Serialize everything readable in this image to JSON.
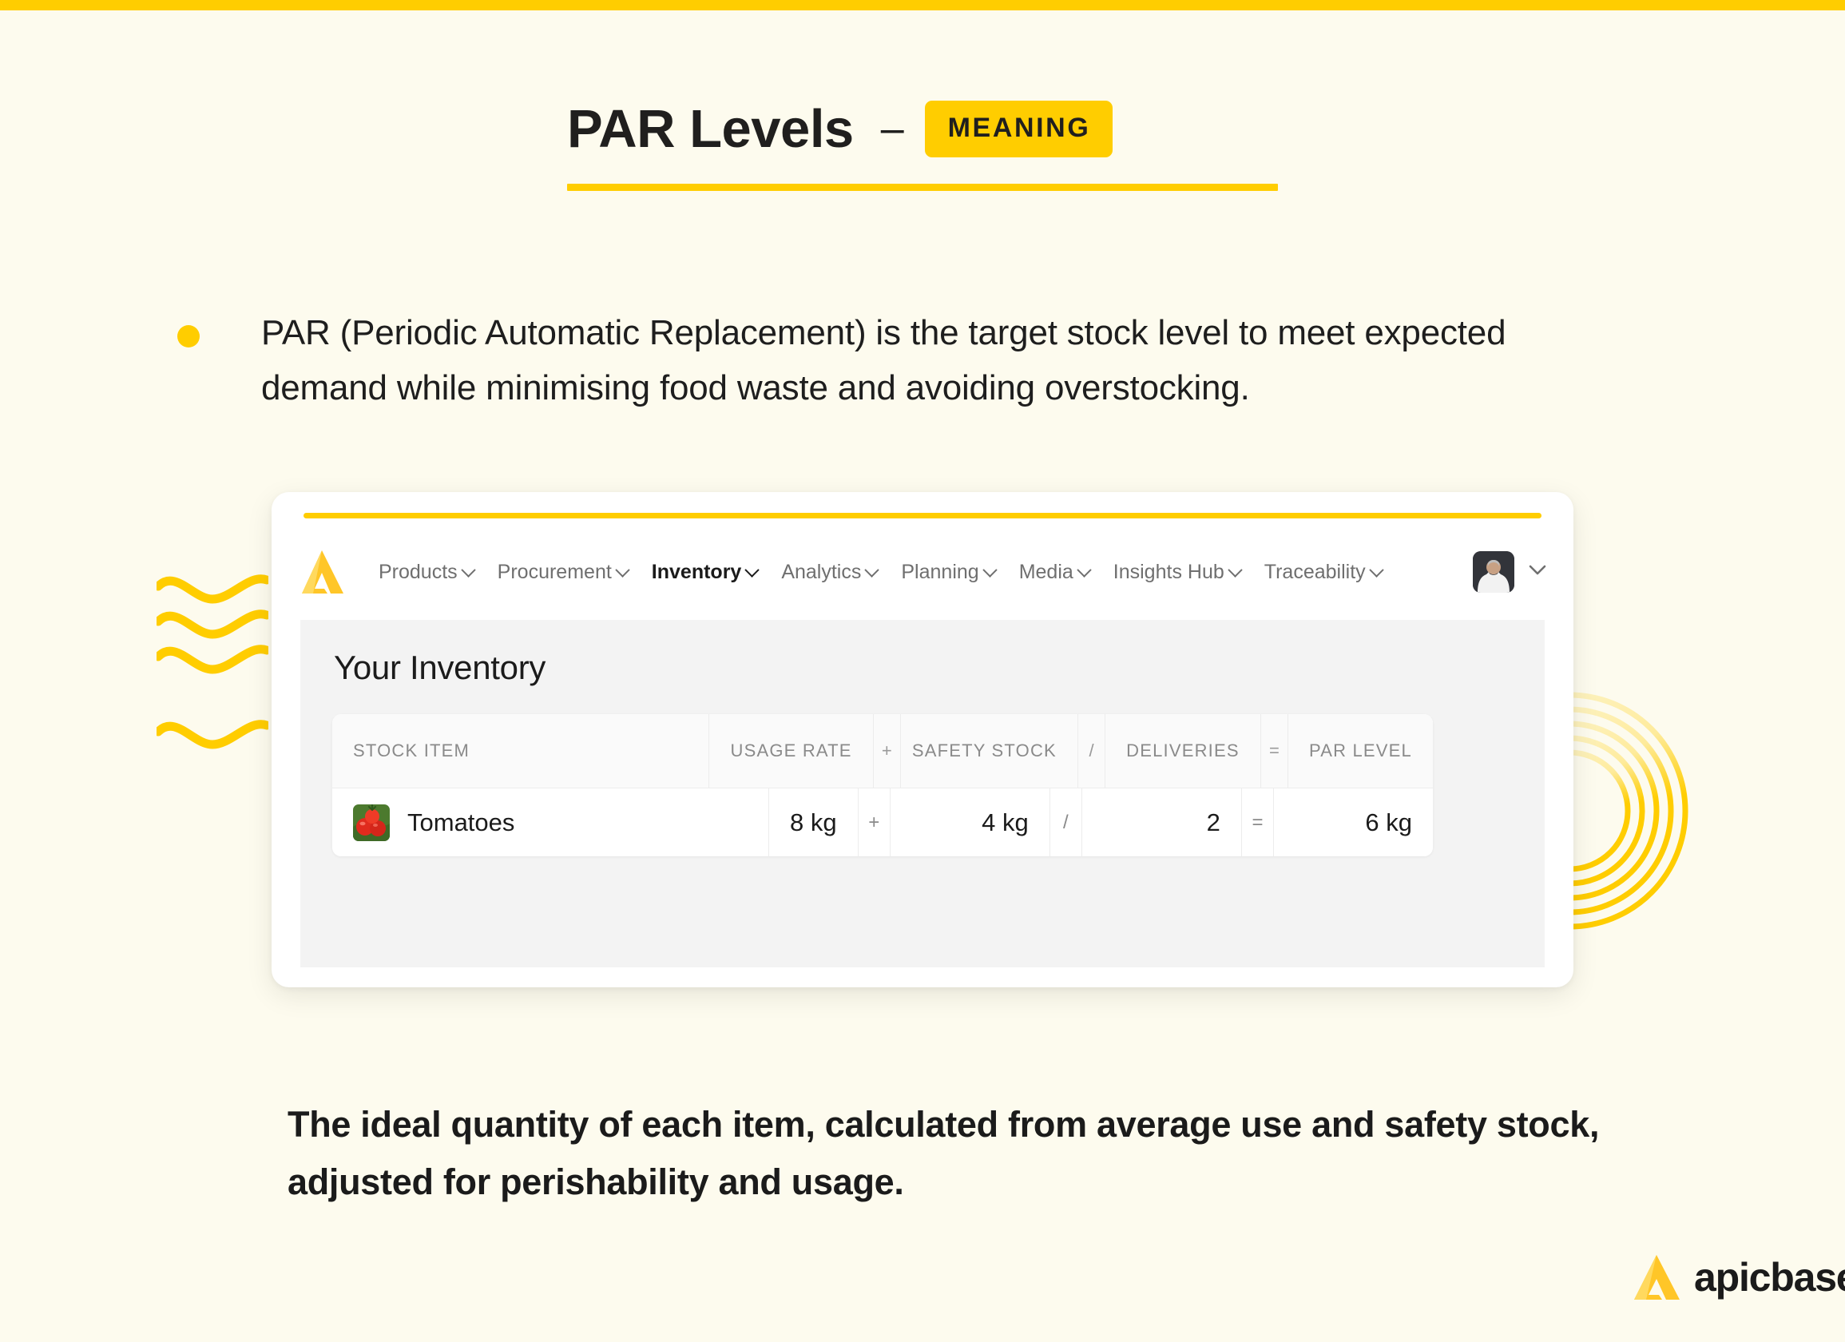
{
  "theme": {
    "background": "#FDFBEE",
    "accent_yellow": "#FFCD00",
    "text_dark": "#1B1B1B",
    "muted": "#8A8A8A",
    "card_white": "#FFFFFF",
    "pane_gray": "#F3F3F3"
  },
  "header": {
    "title": "PAR Levels",
    "dash": "–",
    "badge": "MEANING"
  },
  "intro": {
    "bullet_text": "PAR (Periodic Automatic Replacement) is the target stock level to meet expected demand while minimising food waste and avoiding overstocking."
  },
  "app": {
    "brand_icon": "apicbase-a-logo",
    "nav": [
      {
        "label": "Products",
        "active": false,
        "has_chevron": true
      },
      {
        "label": "Procurement",
        "active": false,
        "has_chevron": true
      },
      {
        "label": "Inventory",
        "active": true,
        "has_chevron": true
      },
      {
        "label": "Analytics",
        "active": false,
        "has_chevron": true
      },
      {
        "label": "Planning",
        "active": false,
        "has_chevron": true
      },
      {
        "label": "Media",
        "active": false,
        "has_chevron": true
      },
      {
        "label": "Insights Hub",
        "active": false,
        "has_chevron": true
      },
      {
        "label": "Traceability",
        "active": false,
        "has_chevron": true
      }
    ],
    "avatar": "user-avatar-photo",
    "avatar_chevron": "chevron-down-icon",
    "page_title": "Your Inventory",
    "table": {
      "columns": [
        {
          "key": "stock_item",
          "label": "STOCK ITEM",
          "align": "left"
        },
        {
          "key": "usage_rate",
          "label": "USAGE RATE",
          "align": "right"
        },
        {
          "key": "op1",
          "label": "+",
          "align": "center"
        },
        {
          "key": "safety_stock",
          "label": "SAFETY STOCK",
          "align": "right"
        },
        {
          "key": "op2",
          "label": "/",
          "align": "center"
        },
        {
          "key": "deliveries",
          "label": "DELIVERIES",
          "align": "right"
        },
        {
          "key": "op3",
          "label": "=",
          "align": "center"
        },
        {
          "key": "par_level",
          "label": "PAR LEVEL",
          "align": "right"
        }
      ],
      "rows": [
        {
          "thumbnail": "tomatoes-photo",
          "stock_item": "Tomatoes",
          "usage_rate": "8 kg",
          "op1": "+",
          "safety_stock": "4 kg",
          "op2": "/",
          "deliveries": "2",
          "op3": "=",
          "par_level": "6 kg"
        }
      ]
    }
  },
  "definition": {
    "icon": "equals-icon",
    "text": "The ideal quantity of each item, calculated from average use and safety stock, adjusted for perishability and usage."
  },
  "footer": {
    "logo_mark": "apicbase-a-logo",
    "brand_name": "apicbase"
  }
}
